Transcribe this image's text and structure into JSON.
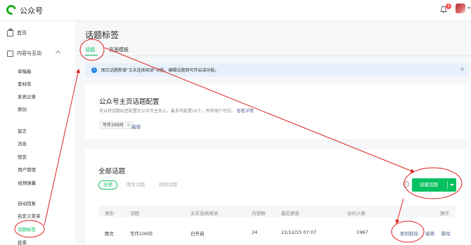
{
  "app": {
    "name": "公众号",
    "notification_count": "1"
  },
  "sidebar": {
    "home": "首页",
    "content_group": "内容与互动",
    "items": [
      "草稿箱",
      "素材库",
      "发表记录",
      "原创",
      "留言",
      "消息",
      "赞赏",
      "用户管理",
      "视频弹幕",
      "自动回复",
      "自定义菜单",
      "话题标签",
      "投票"
    ]
  },
  "page": {
    "title": "话题标签",
    "tabs": [
      "话题",
      "页面模板"
    ],
    "notice": "图文话题新增\"文末连续阅读\"功能。编辑话题即可开启该功能。"
  },
  "config_card": {
    "title": "公众号主页话题配置",
    "desc": "可以将话题标签配置在公众号主页上，最多可配置10个。所有用户可见。",
    "desc_link": "查看详情",
    "chip": "写作100问",
    "chip_close": "×",
    "edit": "编辑"
  },
  "topics_card": {
    "title": "全部话题",
    "filters": [
      "全部",
      "图文话题",
      "视频话题"
    ],
    "help": "?",
    "create_button": "创建话题",
    "columns": [
      "类别",
      "话题",
      "文末连续阅读",
      "内容数",
      "最后更新",
      "访问人数",
      "操作"
    ],
    "rows": [
      {
        "type": "图文",
        "topic": "写作100问",
        "continuous_reading": "已开启",
        "count": "24",
        "updated": "21/12/15 07:07",
        "visitors": "1967",
        "actions": [
          "复制链接",
          "编辑",
          "删除"
        ]
      }
    ]
  },
  "colors": {
    "brand": "#07c160",
    "link": "#576b95",
    "annotation": "#e02020",
    "notice_bg": "#e8f0fb"
  }
}
